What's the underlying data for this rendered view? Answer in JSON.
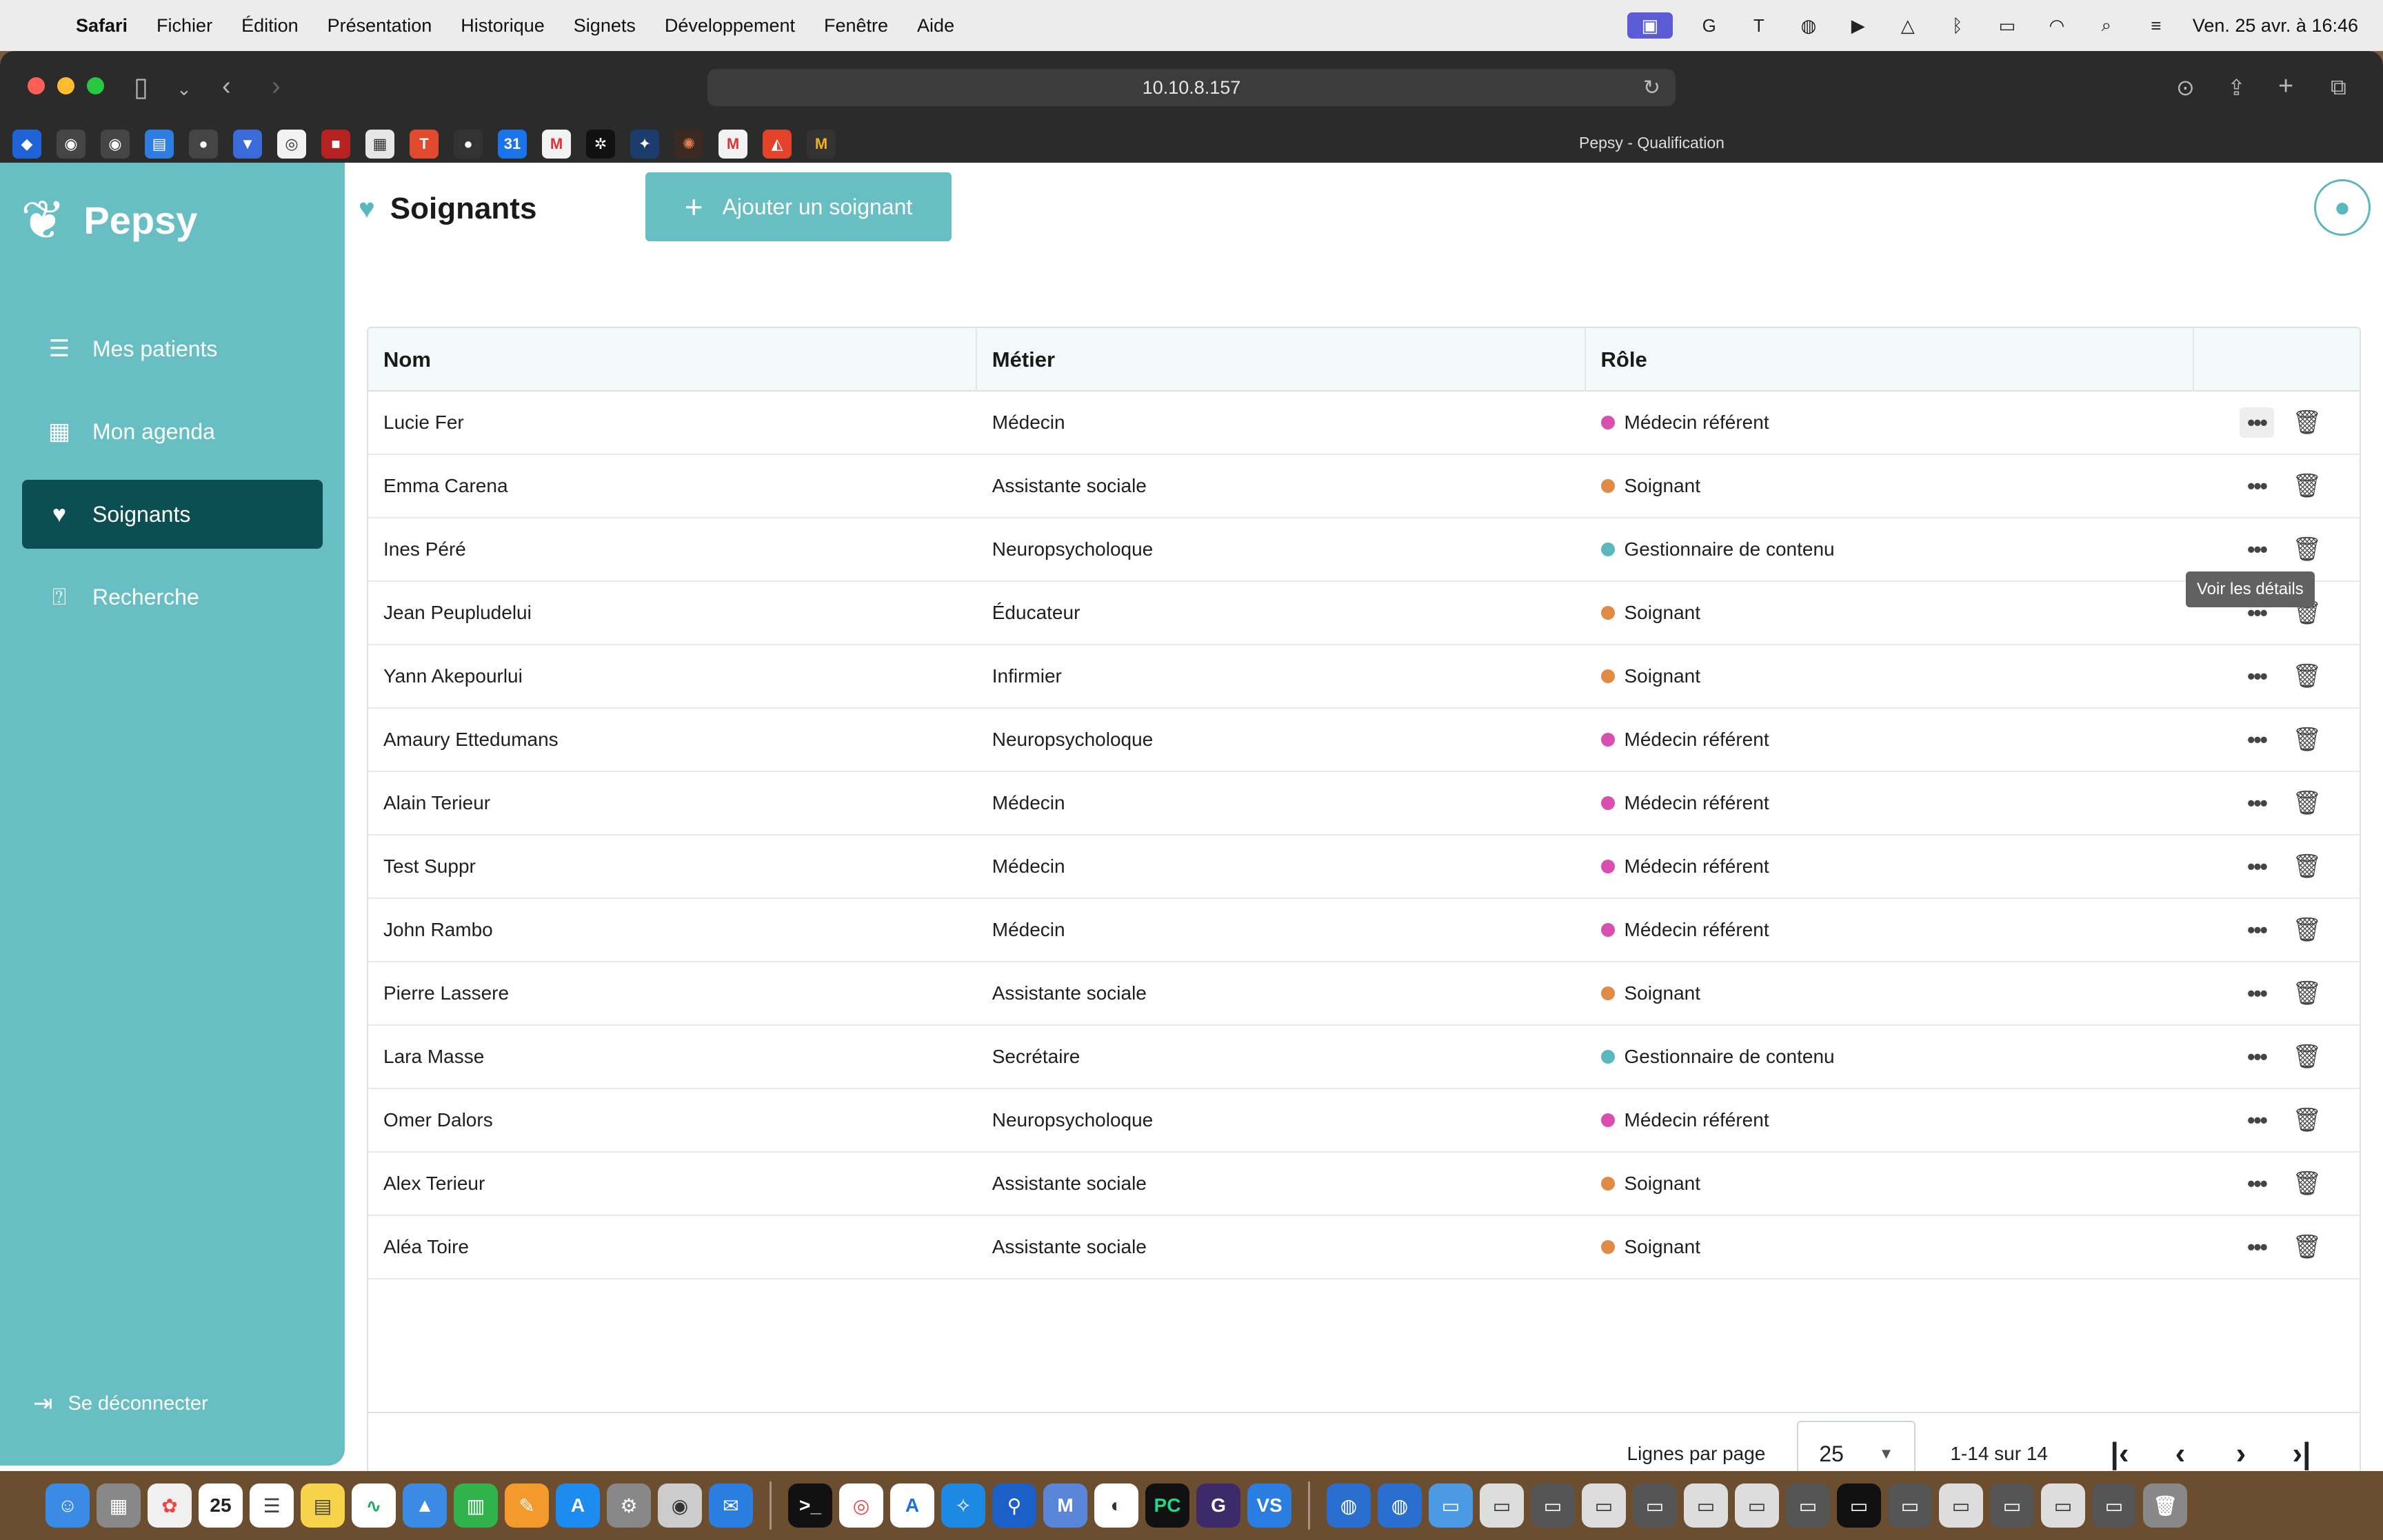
{
  "menubar": {
    "app_name": "Safari",
    "items": [
      "Fichier",
      "Édition",
      "Présentation",
      "Historique",
      "Signets",
      "Développement",
      "Fenêtre",
      "Aide"
    ],
    "clock": "Ven. 25 avr. à 16:46"
  },
  "browser": {
    "url": "10.10.8.157",
    "tab_title": "Pepsy - Qualification"
  },
  "app": {
    "logo_text": "Pepsy",
    "nav": [
      {
        "label": "Mes patients",
        "icon": "patients-list-icon"
      },
      {
        "label": "Mon agenda",
        "icon": "calendar-icon"
      },
      {
        "label": "Soignants",
        "icon": "caregiver-icon",
        "active": true
      },
      {
        "label": "Recherche",
        "icon": "research-icon"
      }
    ],
    "logout_label": "Se déconnecter",
    "page_title": "Soignants",
    "add_button_label": "Ajouter un soignant"
  },
  "table": {
    "columns": [
      "Nom",
      "Métier",
      "Rôle"
    ],
    "rows": [
      {
        "nom": "Lucie Fer",
        "metier": "Médecin",
        "role": "Médecin référent",
        "role_color": "#d94fae"
      },
      {
        "nom": "Emma Carena",
        "metier": "Assistante sociale",
        "role": "Soignant",
        "role_color": "#e08a45"
      },
      {
        "nom": "Ines Péré",
        "metier": "Neuropsycholoque",
        "role": "Gestionnaire de contenu",
        "role_color": "#5ab8bd"
      },
      {
        "nom": "Jean Peupludelui",
        "metier": "Éducateur",
        "role": "Soignant",
        "role_color": "#e08a45"
      },
      {
        "nom": "Yann Akepourlui",
        "metier": "Infirmier",
        "role": "Soignant",
        "role_color": "#e08a45"
      },
      {
        "nom": "Amaury Ettedumans",
        "metier": "Neuropsycholoque",
        "role": "Médecin référent",
        "role_color": "#d94fae"
      },
      {
        "nom": "Alain Terieur",
        "metier": "Médecin",
        "role": "Médecin référent",
        "role_color": "#d94fae"
      },
      {
        "nom": "Test Suppr",
        "metier": "Médecin",
        "role": "Médecin référent",
        "role_color": "#d94fae"
      },
      {
        "nom": "John Rambo",
        "metier": "Médecin",
        "role": "Médecin référent",
        "role_color": "#d94fae"
      },
      {
        "nom": "Pierre Lassere",
        "metier": "Assistante sociale",
        "role": "Soignant",
        "role_color": "#e08a45"
      },
      {
        "nom": "Lara Masse",
        "metier": "Secrétaire",
        "role": "Gestionnaire de contenu",
        "role_color": "#5ab8bd"
      },
      {
        "nom": "Omer Dalors",
        "metier": "Neuropsycholoque",
        "role": "Médecin référent",
        "role_color": "#d94fae"
      },
      {
        "nom": "Alex Terieur",
        "metier": "Assistante sociale",
        "role": "Soignant",
        "role_color": "#e08a45"
      },
      {
        "nom": "Aléa Toire",
        "metier": "Assistante sociale",
        "role": "Soignant",
        "role_color": "#e08a45"
      }
    ],
    "tooltip": "Voir les détails"
  },
  "pagination": {
    "rows_per_page_label": "Lignes par page",
    "rows_per_page_value": "25",
    "range_text": "1-14 sur 14"
  },
  "colors": {
    "sidebar": "#67bfc4",
    "active_nav": "#0c4f52",
    "accent": "#5ab8bd"
  }
}
